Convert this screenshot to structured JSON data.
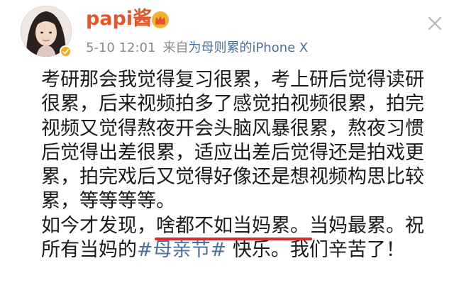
{
  "author": {
    "name": "papi酱",
    "vip_icon": "crown-icon",
    "verified_icon": "verified-badge-icon"
  },
  "meta": {
    "time": "5-10 12:01",
    "source_prefix": "来自",
    "source_name": "为母则累的iPhone X"
  },
  "post": {
    "lines": [
      "考研那会我觉得复习很累，考上研后觉得读研",
      "很累，后来视频拍多了感觉拍视频很累，拍完",
      "视频又觉得熬夜开会头脑风暴很累，熬夜习惯",
      "后觉得出差很累，适应出差后觉得还是拍戏更",
      "累，拍完戏后又觉得好像还是想视频构思比较",
      "累，等等等等。"
    ],
    "line7_before": "如今才发现，",
    "line7_underlined": "啥都不如当妈累。",
    "line7_after": "当妈最累。祝",
    "line8_before": "所有当妈的",
    "hashtag": "#母亲节#",
    "line8_after": " 快乐。我们辛苦了！"
  },
  "colors": {
    "username": "#e5552c",
    "link": "#4b6f9c",
    "underline": "#d62e2e",
    "meta": "#8a8a8a"
  }
}
